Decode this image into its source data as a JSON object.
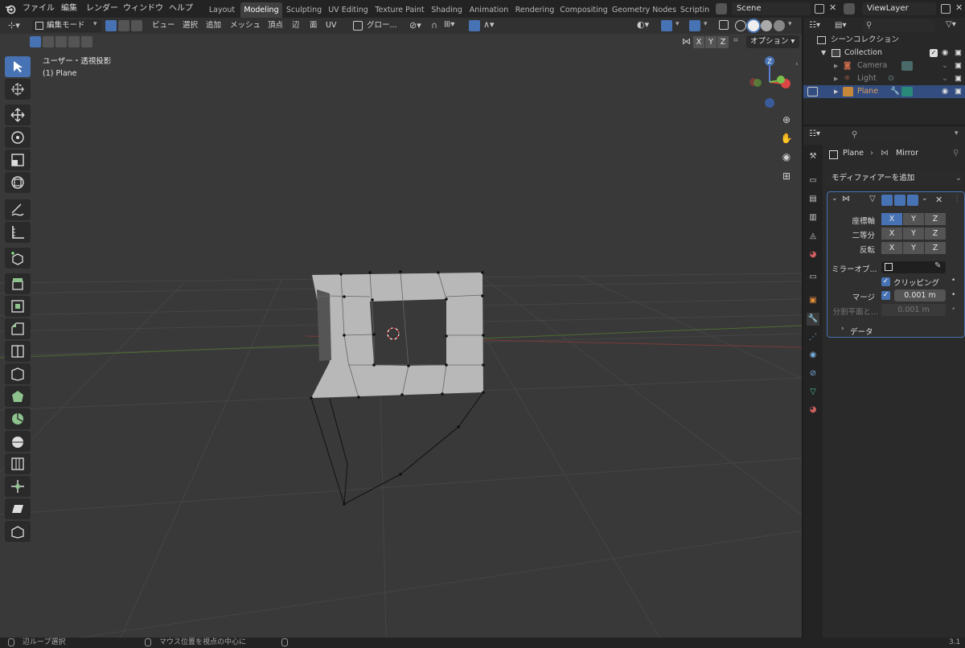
{
  "menu": {
    "file": "ファイル",
    "edit": "編集",
    "render": "レンダー",
    "window": "ウィンドウ",
    "help": "ヘルプ"
  },
  "workspaces": [
    "Layout",
    "Modeling",
    "Sculpting",
    "UV Editing",
    "Texture Paint",
    "Shading",
    "Animation",
    "Rendering",
    "Compositing",
    "Geometry Nodes",
    "Scriptin"
  ],
  "active_workspace": "Modeling",
  "scene": "Scene",
  "viewlayer": "ViewLayer",
  "viewport_header": {
    "mode": "編集モード",
    "view": "ビュー",
    "select": "選択",
    "add": "追加",
    "mesh": "メッシュ",
    "vertex": "頂点",
    "edge": "辺",
    "face": "面",
    "uv": "UV",
    "transform": "グロー...",
    "options": "オプション",
    "axis_x": "X",
    "axis_y": "Y",
    "axis_z": "Z"
  },
  "overlay": {
    "view_name": "ユーザー・透視投影",
    "object": "(1) Plane"
  },
  "gizmo": {
    "z": "Z"
  },
  "outliner": {
    "scene_collection": "シーンコレクション",
    "collection": "Collection",
    "items": [
      "Camera",
      "Light",
      "Plane"
    ]
  },
  "properties": {
    "object": "Plane",
    "modifier": "Mirror",
    "add_modifier": "モディファイアーを追加",
    "axis_label": "座標軸",
    "bisect_label": "二等分",
    "flip_label": "反転",
    "x": "X",
    "y": "Y",
    "z": "Z",
    "mirror_object_label": "ミラーオブ...",
    "clipping_label": "クリッピング",
    "merge_label": "マージ",
    "merge_value": "0.001 m",
    "bisect_distance_label": "分割平面と...",
    "bisect_distance_value": "0.001 m",
    "data_label": "データ"
  },
  "status": {
    "left": "辺ループ選択",
    "center": "マウス位置を視点の中心に",
    "version": "3.1"
  },
  "colors": {
    "accent": "#4772b3",
    "bg": "#393939",
    "header": "#232323",
    "panel": "#2a2a2a"
  }
}
